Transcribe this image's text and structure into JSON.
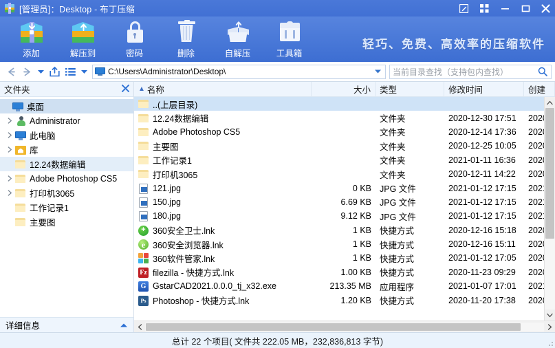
{
  "window": {
    "title": "[管理员]：Desktop - 布丁压缩",
    "logo_icon": "archive-logo-icon",
    "buttons": [
      {
        "name": "feedback-button",
        "icon": "pencil-square-icon"
      },
      {
        "name": "apps-button",
        "icon": "grid-squares-icon"
      },
      {
        "name": "minimize-button",
        "icon": "minimize-icon"
      },
      {
        "name": "maximize-button",
        "icon": "maximize-icon"
      },
      {
        "name": "close-button",
        "icon": "close-icon"
      }
    ]
  },
  "toolbar": {
    "slogan": "轻巧、免费、高效率的压缩软件",
    "items": [
      {
        "label": "添加",
        "icon": "archive-add-icon"
      },
      {
        "label": "解压到",
        "icon": "archive-extract-icon"
      },
      {
        "label": "密码",
        "icon": "lock-icon"
      },
      {
        "label": "删除",
        "icon": "trash-icon"
      },
      {
        "label": "自解压",
        "icon": "open-box-icon"
      },
      {
        "label": "工具箱",
        "icon": "toolbox-icon"
      }
    ]
  },
  "addressbar": {
    "back_icon": "back-arrow-icon",
    "forward_icon": "forward-arrow-icon",
    "history_icon": "chevron-down-icon",
    "upload_icon": "upload-box-icon",
    "list_icon": "list-view-icon",
    "view_caret_icon": "chevron-down-icon",
    "path": "C:\\Users\\Administrator\\Desktop\\",
    "path_icon": "monitor-icon",
    "path_caret_icon": "chevron-down-icon",
    "search_placeholder": "当前目录查找（支持包内查找）",
    "search_icon": "search-icon"
  },
  "sidebar": {
    "title": "文件夹",
    "close_icon": "close-icon",
    "detail_title": "详细信息",
    "detail_caret_icon": "chevron-up-icon",
    "items": [
      {
        "label": "桌面",
        "icon": "monitor-icon",
        "expander": false,
        "state": "selected",
        "indent": 0
      },
      {
        "label": "Administrator",
        "icon": "user-icon",
        "expander": true,
        "state": "",
        "indent": 1
      },
      {
        "label": "此电脑",
        "icon": "monitor-icon",
        "expander": true,
        "state": "",
        "indent": 1
      },
      {
        "label": "库",
        "icon": "library-icon",
        "expander": true,
        "state": "",
        "indent": 1
      },
      {
        "label": "12.24数据编辑",
        "icon": "folder-icon",
        "expander": false,
        "state": "hover",
        "indent": 1
      },
      {
        "label": "Adobe Photoshop CS5",
        "icon": "folder-icon",
        "expander": true,
        "state": "",
        "indent": 1
      },
      {
        "label": "打印机3065",
        "icon": "folder-icon",
        "expander": true,
        "state": "",
        "indent": 1
      },
      {
        "label": "工作记录1",
        "icon": "folder-icon",
        "expander": false,
        "state": "",
        "indent": 1
      },
      {
        "label": "主要图",
        "icon": "folder-icon",
        "expander": false,
        "state": "",
        "indent": 1
      }
    ]
  },
  "filelist": {
    "columns": [
      {
        "label": "名称",
        "sorted": true,
        "sort_icon": "sort-ascending-icon"
      },
      {
        "label": "大小",
        "sorted": false
      },
      {
        "label": "类型",
        "sorted": false
      },
      {
        "label": "修改时间",
        "sorted": false
      },
      {
        "label": "创建",
        "sorted": false
      }
    ],
    "rows": [
      {
        "name": "..(上层目录)",
        "icon": "folder-icon",
        "size": "",
        "type": "",
        "modified": "",
        "created": "",
        "selected": true
      },
      {
        "name": "12.24数据编辑",
        "icon": "folder-icon",
        "size": "",
        "type": "文件夹",
        "modified": "2020-12-30 17:51",
        "created": "2020",
        "selected": false
      },
      {
        "name": "Adobe Photoshop CS5",
        "icon": "folder-icon",
        "size": "",
        "type": "文件夹",
        "modified": "2020-12-14 17:36",
        "created": "2020",
        "selected": false
      },
      {
        "name": "主要图",
        "icon": "folder-icon",
        "size": "",
        "type": "文件夹",
        "modified": "2020-12-25 10:05",
        "created": "2020",
        "selected": false
      },
      {
        "name": "工作记录1",
        "icon": "folder-icon",
        "size": "",
        "type": "文件夹",
        "modified": "2021-01-11 16:36",
        "created": "2020",
        "selected": false
      },
      {
        "name": "打印机3065",
        "icon": "folder-icon",
        "size": "",
        "type": "文件夹",
        "modified": "2020-12-11 14:22",
        "created": "2020",
        "selected": false
      },
      {
        "name": "121.jpg",
        "icon": "jpg-file-icon",
        "size": "0 KB",
        "type": "JPG 文件",
        "modified": "2021-01-12 17:15",
        "created": "2021",
        "selected": false
      },
      {
        "name": "150.jpg",
        "icon": "jpg-file-icon",
        "size": "6.69 KB",
        "type": "JPG 文件",
        "modified": "2021-01-12 17:15",
        "created": "2021",
        "selected": false
      },
      {
        "name": "180.jpg",
        "icon": "jpg-file-icon",
        "size": "9.12 KB",
        "type": "JPG 文件",
        "modified": "2021-01-12 17:15",
        "created": "2021",
        "selected": false
      },
      {
        "name": "360安全卫士.lnk",
        "icon": "360-shield-icon",
        "size": "1 KB",
        "type": "快捷方式",
        "modified": "2020-12-16 15:18",
        "created": "2020",
        "selected": false
      },
      {
        "name": "360安全浏览器.lnk",
        "icon": "360-browser-icon",
        "size": "1 KB",
        "type": "快捷方式",
        "modified": "2020-12-16 15:11",
        "created": "2020",
        "selected": false
      },
      {
        "name": "360软件管家.lnk",
        "icon": "360-softmgr-icon",
        "size": "1 KB",
        "type": "快捷方式",
        "modified": "2021-01-12 17:05",
        "created": "2020",
        "selected": false
      },
      {
        "name": "filezilla - 快捷方式.lnk",
        "icon": "filezilla-icon",
        "size": "1.00 KB",
        "type": "快捷方式",
        "modified": "2020-11-23 09:29",
        "created": "2020",
        "selected": false
      },
      {
        "name": "GstarCAD2021.0.0.0_tj_x32.exe",
        "icon": "gstarcad-icon",
        "size": "213.35 MB",
        "type": "应用程序",
        "modified": "2021-01-07 17:01",
        "created": "2021",
        "selected": false
      },
      {
        "name": "Photoshop - 快捷方式.lnk",
        "icon": "photoshop-icon",
        "size": "1.20 KB",
        "type": "快捷方式",
        "modified": "2020-11-20 17:38",
        "created": "2020",
        "selected": false
      }
    ]
  },
  "statusbar": {
    "text": "总计 22 个项目( 文件共 222.05 MB，232,836,813 字节)"
  }
}
